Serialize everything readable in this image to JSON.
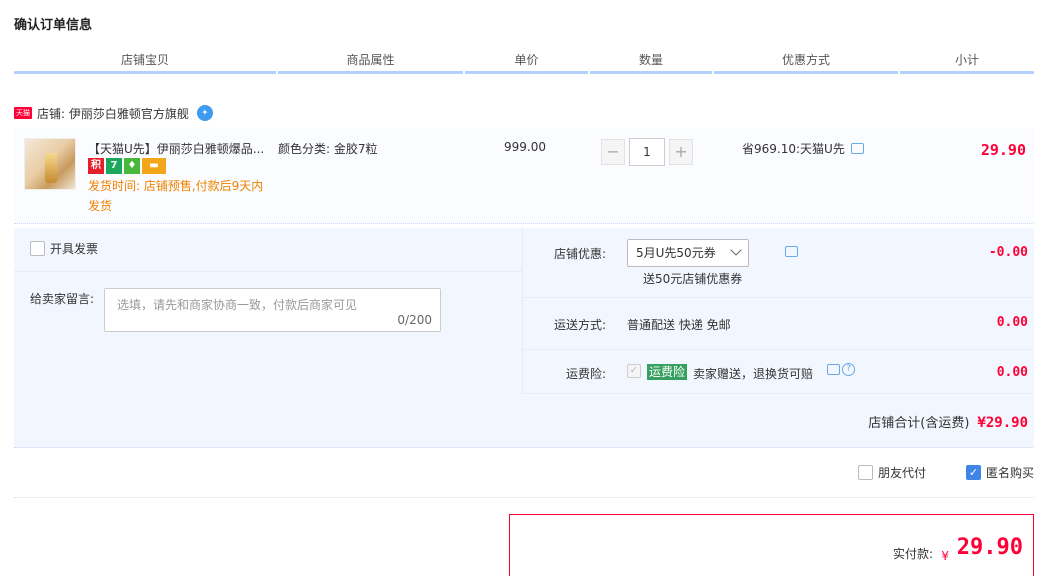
{
  "page_title": "确认订单信息",
  "columns": [
    "店铺宝贝",
    "商品属性",
    "单价",
    "数量",
    "优惠方式",
    "小计"
  ],
  "shop": {
    "badge": "天猫",
    "label": "店铺: 伊丽莎白雅顿官方旗舰"
  },
  "item": {
    "title": "【天猫U先】伊丽莎白雅顿爆品...",
    "badges": [
      "积",
      "7",
      "",
      ""
    ],
    "ship_time": "发货时间: 店铺预售,付款后9天内发货",
    "attr": "颜色分类: 金胶7粒",
    "unit_price": "999.00",
    "qty": "1",
    "discount": "省969.10:天猫U先",
    "subtotal": "29.90"
  },
  "invoice": {
    "label": "开具发票"
  },
  "message": {
    "label": "给卖家留言:",
    "placeholder": "选填，请先和商家协商一致，付款后商家可见",
    "counter": "0/200"
  },
  "shop_coupon": {
    "label": "店铺优惠:",
    "selected": "5月U先50元券",
    "note": "送50元店铺优惠券",
    "amount": "-0.00"
  },
  "shipping": {
    "label": "运送方式:",
    "method": "普通配送 快递 免邮",
    "amount": "0.00"
  },
  "insurance": {
    "label": "运费险:",
    "tag": "运费险",
    "text": "卖家赠送，退换货可赔",
    "amount": "0.00"
  },
  "shop_total": {
    "label": "店铺合计(含运费)",
    "amount": "¥29.90"
  },
  "options": {
    "friend_pay": "朋友代付",
    "anonymous": "匿名购买"
  },
  "payment": {
    "label": "实付款:",
    "currency": "¥",
    "amount": "29.90"
  },
  "colors": {
    "price_red": "#ff0036",
    "accent_blue": "#3f85e8",
    "header_underline": "#b2d1ff",
    "panel_bg": "#f2f7ff"
  }
}
